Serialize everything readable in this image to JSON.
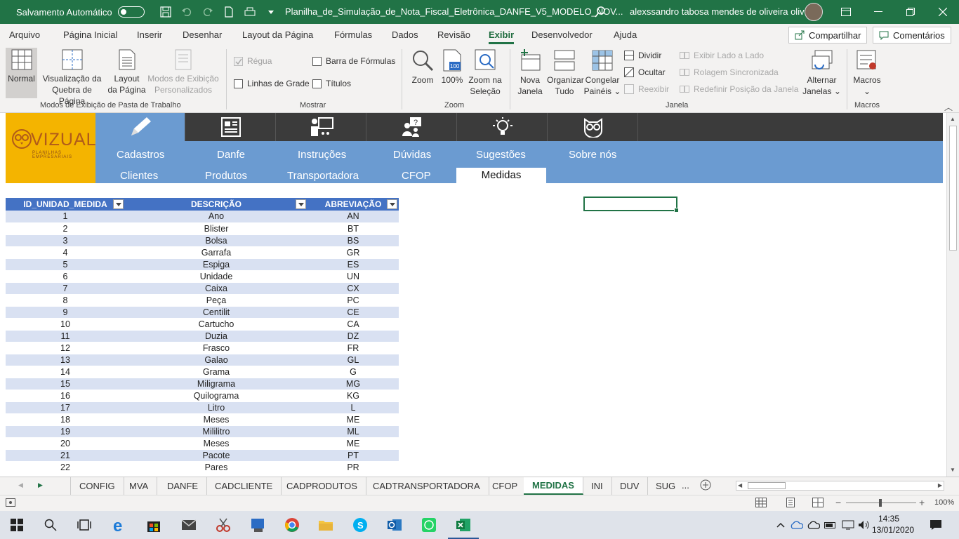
{
  "titlebar": {
    "autosave": "Salvamento Automático",
    "filename": "Planilha_de_Simulação_de_Nota_Fiscal_Eletrônica_DANFE_V5_MODELO_NOV...",
    "user": "alexssandro tabosa mendes de oliveira oliveira"
  },
  "menu": {
    "items": [
      "Arquivo",
      "Página Inicial",
      "Inserir",
      "Desenhar",
      "Layout da Página",
      "Fórmulas",
      "Dados",
      "Revisão",
      "Exibir",
      "Desenvolvedor",
      "Ajuda"
    ],
    "active": "Exibir",
    "share": "Compartilhar",
    "comments": "Comentários"
  },
  "ribbon": {
    "views": {
      "normal": "Normal",
      "pagebreak1": "Visualização da",
      "pagebreak2": "Quebra de Página",
      "layout1": "Layout",
      "layout2": "da Página",
      "custom1": "Modos de Exibição",
      "custom2": "Personalizados",
      "group": "Modos de Exibição de Pasta de Trabalho"
    },
    "show": {
      "ruler": "Régua",
      "formula_bar": "Barra de Fórmulas",
      "gridlines": "Linhas de Grade",
      "headings": "Títulos",
      "group": "Mostrar"
    },
    "zoom": {
      "zoom": "Zoom",
      "hundred": "100%",
      "sel1": "Zoom na",
      "sel2": "Seleção",
      "group": "Zoom",
      "icon_text": "100"
    },
    "window": {
      "new1": "Nova",
      "new2": "Janela",
      "arrange1": "Organizar",
      "arrange2": "Tudo",
      "freeze1": "Congelar",
      "freeze2": "Painéis",
      "split": "Dividir",
      "hide": "Ocultar",
      "unhide": "Reexibir",
      "side": "Exibir Lado a Lado",
      "sync": "Rolagem Sincronizada",
      "reset": "Redefinir Posição da Janela",
      "switch1": "Alternar",
      "switch2": "Janelas",
      "group": "Janela"
    },
    "macros": {
      "label": "Macros",
      "group": "Macros"
    }
  },
  "banner": {
    "logo_text": "VIZUAL",
    "logo_sub": "PLANILHAS EMPRESARIAIS",
    "nav_icons": [
      "pencil-icon",
      "newspaper-icon",
      "presenter-icon",
      "question-people-icon",
      "lightbulb-icon",
      "owl-icon"
    ],
    "row1": [
      "Cadastros",
      "Danfe",
      "Instruções",
      "Dúvidas",
      "Sugestões",
      "Sobre nós"
    ],
    "row2": [
      "Clientes",
      "Produtos",
      "Transportadora",
      "CFOP",
      "Medidas"
    ],
    "row2_active": "Medidas"
  },
  "table": {
    "headers": [
      "ID_UNIDAD_MEDIDA",
      "DESCRIÇÃO",
      "ABREVIAÇÃO"
    ],
    "rows": [
      [
        "1",
        "Ano",
        "AN"
      ],
      [
        "2",
        "Blister",
        "BT"
      ],
      [
        "3",
        "Bolsa",
        "BS"
      ],
      [
        "4",
        "Garrafa",
        "GR"
      ],
      [
        "5",
        "Espiga",
        "ES"
      ],
      [
        "6",
        "Unidade",
        "UN"
      ],
      [
        "7",
        "Caixa",
        "CX"
      ],
      [
        "8",
        "Peça",
        "PC"
      ],
      [
        "9",
        "Centilit",
        "CE"
      ],
      [
        "10",
        "Cartucho",
        "CA"
      ],
      [
        "11",
        "Duzia",
        "DZ"
      ],
      [
        "12",
        "Frasco",
        "FR"
      ],
      [
        "13",
        "Galao",
        "GL"
      ],
      [
        "14",
        "Grama",
        "G"
      ],
      [
        "15",
        "Miligrama",
        "MG"
      ],
      [
        "16",
        "Quilograma",
        "KG"
      ],
      [
        "17",
        "Litro",
        "L"
      ],
      [
        "18",
        "Meses",
        "ME"
      ],
      [
        "19",
        "Mililitro",
        "ML"
      ],
      [
        "20",
        "Meses",
        "ME"
      ],
      [
        "21",
        "Pacote",
        "PT"
      ],
      [
        "22",
        "Pares",
        "PR"
      ]
    ]
  },
  "sheet_tabs": {
    "tabs": [
      "CONFIG",
      "MVA",
      "DANFE",
      "CADCLIENTE",
      "CADPRODUTOS",
      "CADTRANSPORTADORA",
      "CFOP",
      "MEDIDAS",
      "INI",
      "DUV",
      "SUG"
    ],
    "active": "MEDIDAS",
    "more": "..."
  },
  "status": {
    "zoom": "100%"
  },
  "taskbar": {
    "time": "14:35",
    "date": "13/01/2020"
  },
  "colors": {
    "excel_green": "#217346",
    "table_header": "#4472c4",
    "banner_blue": "#6b9bd1",
    "logo_yellow": "#f4b400"
  }
}
